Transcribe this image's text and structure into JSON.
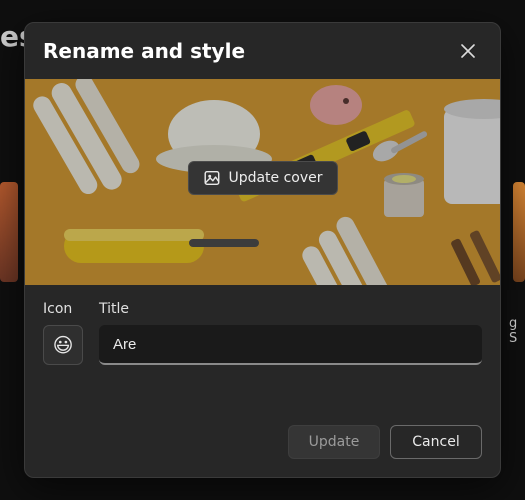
{
  "background": {
    "partial_text": "es",
    "right_card_hint": "g S"
  },
  "dialog": {
    "title": "Rename and style",
    "cover": {
      "button_label": "Update cover"
    },
    "form": {
      "icon_label": "Icon",
      "title_label": "Title",
      "icon_emoji": "😃",
      "title_value": "Are",
      "title_placeholder": ""
    },
    "footer": {
      "update_label": "Update",
      "cancel_label": "Cancel"
    }
  }
}
